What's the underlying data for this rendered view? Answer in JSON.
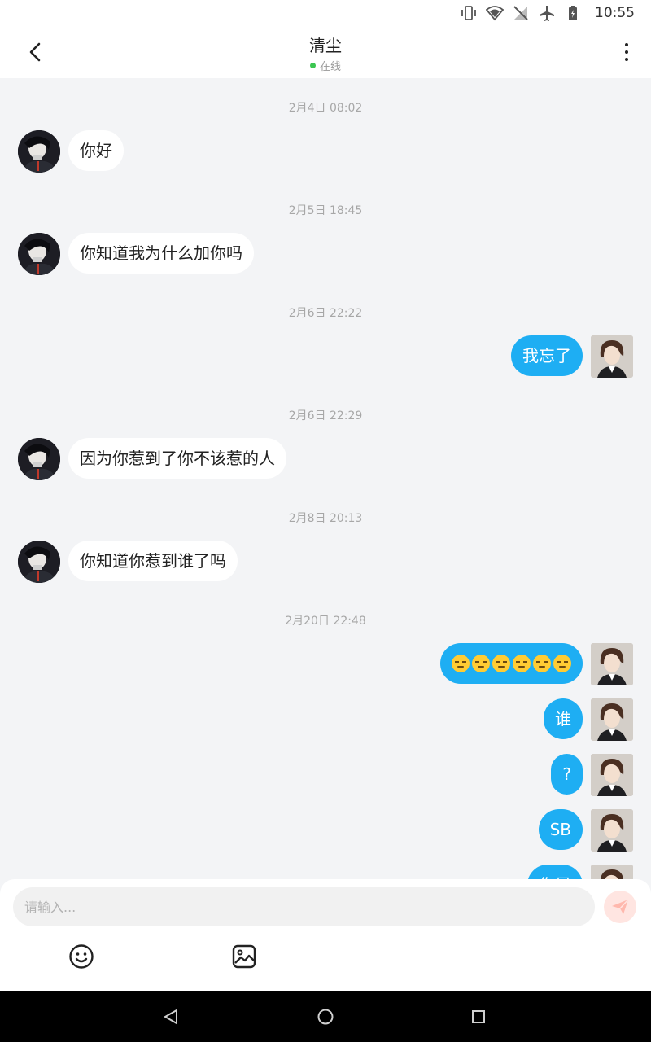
{
  "status_bar": {
    "time": "10:55",
    "icons": [
      "vibrate-icon",
      "wifi-icon",
      "no-signal-icon",
      "airplane-mode-icon",
      "battery-charging-icon"
    ]
  },
  "header": {
    "title": "清尘",
    "status": "在线",
    "status_color": "#3cc651",
    "back_icon": "chevron-left-icon",
    "more_icon": "more-vertical-icon"
  },
  "messages": {
    "ts1": "2月4日 08:02",
    "m1": "你好",
    "ts2": "2月5日 18:45",
    "m2": "你知道我为什么加你吗",
    "ts3": "2月6日 22:22",
    "m3": "我忘了",
    "ts4": "2月6日 22:29",
    "m4": "因为你惹到了你不该惹的人",
    "ts5": "2月8日 20:13",
    "m5": "你知道你惹到谁了吗",
    "ts6": "2月20日 22:48",
    "m6_emoji": "unamused-face-emoji x6",
    "m7": "谁",
    "m8": "?",
    "m9": "SB",
    "m10": "你是"
  },
  "composer": {
    "placeholder": "请输入...",
    "send_icon": "send-icon",
    "emoji_icon": "smiley-icon",
    "image_icon": "image-icon"
  },
  "colors": {
    "bubble_out": "#1eaef3",
    "bubble_in": "#ffffff",
    "background": "#f3f4f6"
  },
  "nav": [
    "back-triangle-icon",
    "home-circle-icon",
    "recents-square-icon"
  ]
}
